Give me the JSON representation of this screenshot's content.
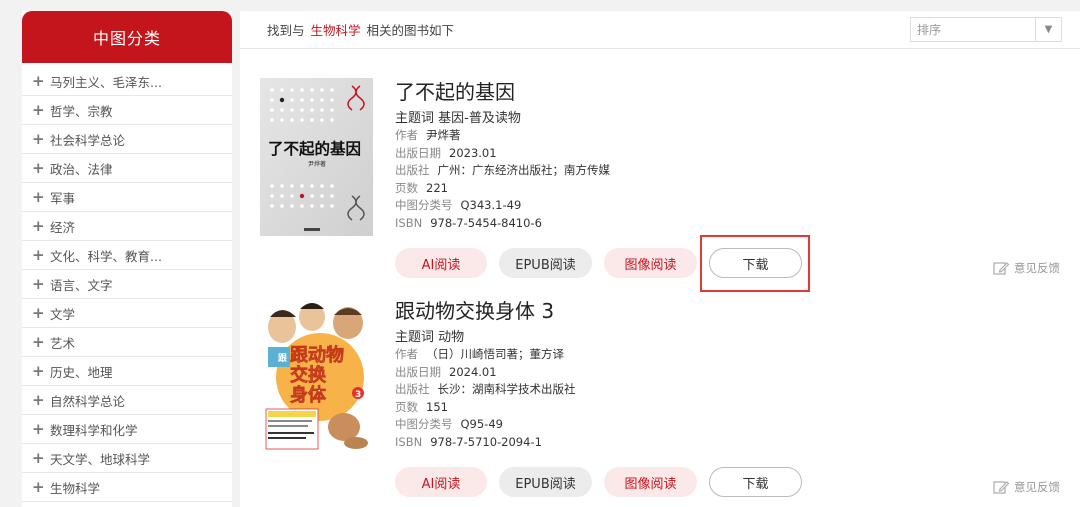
{
  "sidebar": {
    "title": "中图分类",
    "items": [
      {
        "label": "马列主义、毛泽东..."
      },
      {
        "label": "哲学、宗教"
      },
      {
        "label": "社会科学总论"
      },
      {
        "label": "政治、法律"
      },
      {
        "label": "军事"
      },
      {
        "label": "经济"
      },
      {
        "label": "文化、科学、教育..."
      },
      {
        "label": "语言、文字"
      },
      {
        "label": "文学"
      },
      {
        "label": "艺术"
      },
      {
        "label": "历史、地理"
      },
      {
        "label": "自然科学总论"
      },
      {
        "label": "数理科学和化学"
      },
      {
        "label": "天文学、地球科学"
      },
      {
        "label": "生物科学"
      }
    ]
  },
  "search": {
    "prefix": "找到与",
    "keyword": "生物科学",
    "suffix": "相关的图书如下",
    "sort_placeholder": "排序"
  },
  "labels": {
    "subject": "主题词",
    "author": "作者",
    "date": "出版日期",
    "publisher": "出版社",
    "pages": "页数",
    "clc": "中图分类号",
    "isbn": "ISBN",
    "ai_read": "AI阅读",
    "epub_read": "EPUB阅读",
    "image_read": "图像阅读",
    "download": "下载",
    "feedback": "意见反馈"
  },
  "books": [
    {
      "title": "了不起的基因",
      "subject": "基因-普及读物",
      "author": "尹烨著",
      "date": "2023.01",
      "publisher": "广州：广东经济出版社；南方传媒",
      "pages": "221",
      "clc": "Q343.1-49",
      "isbn": "978-7-5454-8410-6",
      "cover_title": "了不起的基因",
      "cover_author": "尹烨",
      "cover_author_suffix": "著"
    },
    {
      "title": "跟动物交换身体 3",
      "subject": "动物",
      "author": "（日）川崎悟司著；董方译",
      "date": "2024.01",
      "publisher": "长沙：湖南科学技术出版社",
      "pages": "151",
      "clc": "Q95-49",
      "isbn": "978-7-5710-2094-1",
      "cover_title_1": "跟动物",
      "cover_title_2": "交换",
      "cover_title_3": "身体",
      "cover_number": "3"
    }
  ],
  "colors": {
    "brand_red": "#c4151c",
    "highlight_red": "#e53935"
  }
}
